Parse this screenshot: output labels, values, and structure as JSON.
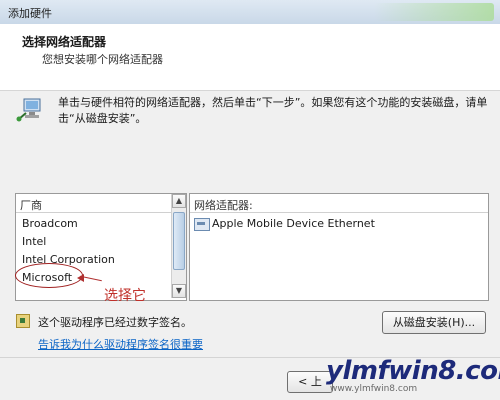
{
  "window": {
    "title": "添加硬件"
  },
  "header": {
    "title": "选择网络适配器",
    "subtitle": "您想安装哪个网络适配器"
  },
  "info": {
    "text": "单击与硬件相符的网络适配器，然后单击“下一步”。如果您有这个功能的安装磁盘，请单击“从磁盘安装”。",
    "icon": "network-computer-icon"
  },
  "manufacturer_list": {
    "header": "厂商",
    "items": [
      "Broadcom",
      "Intel",
      "Intel Corporation",
      "Microsoft"
    ]
  },
  "adapter_list": {
    "header": "网络适配器:",
    "items": [
      "Apple Mobile Device Ethernet"
    ]
  },
  "annotation": {
    "text": "选择它",
    "color": "#c0302a"
  },
  "signature": {
    "text": "这个驱动程序已经过数字签名。",
    "icon": "signed-driver-icon"
  },
  "link": {
    "text": "告诉我为什么驱动程序签名很重要"
  },
  "buttons": {
    "disk_install": "从磁盘安装(H)...",
    "prev": "< 上"
  },
  "watermark": {
    "text": "ylmfwin8.com",
    "sub": "www.ylmfwin8.com"
  }
}
